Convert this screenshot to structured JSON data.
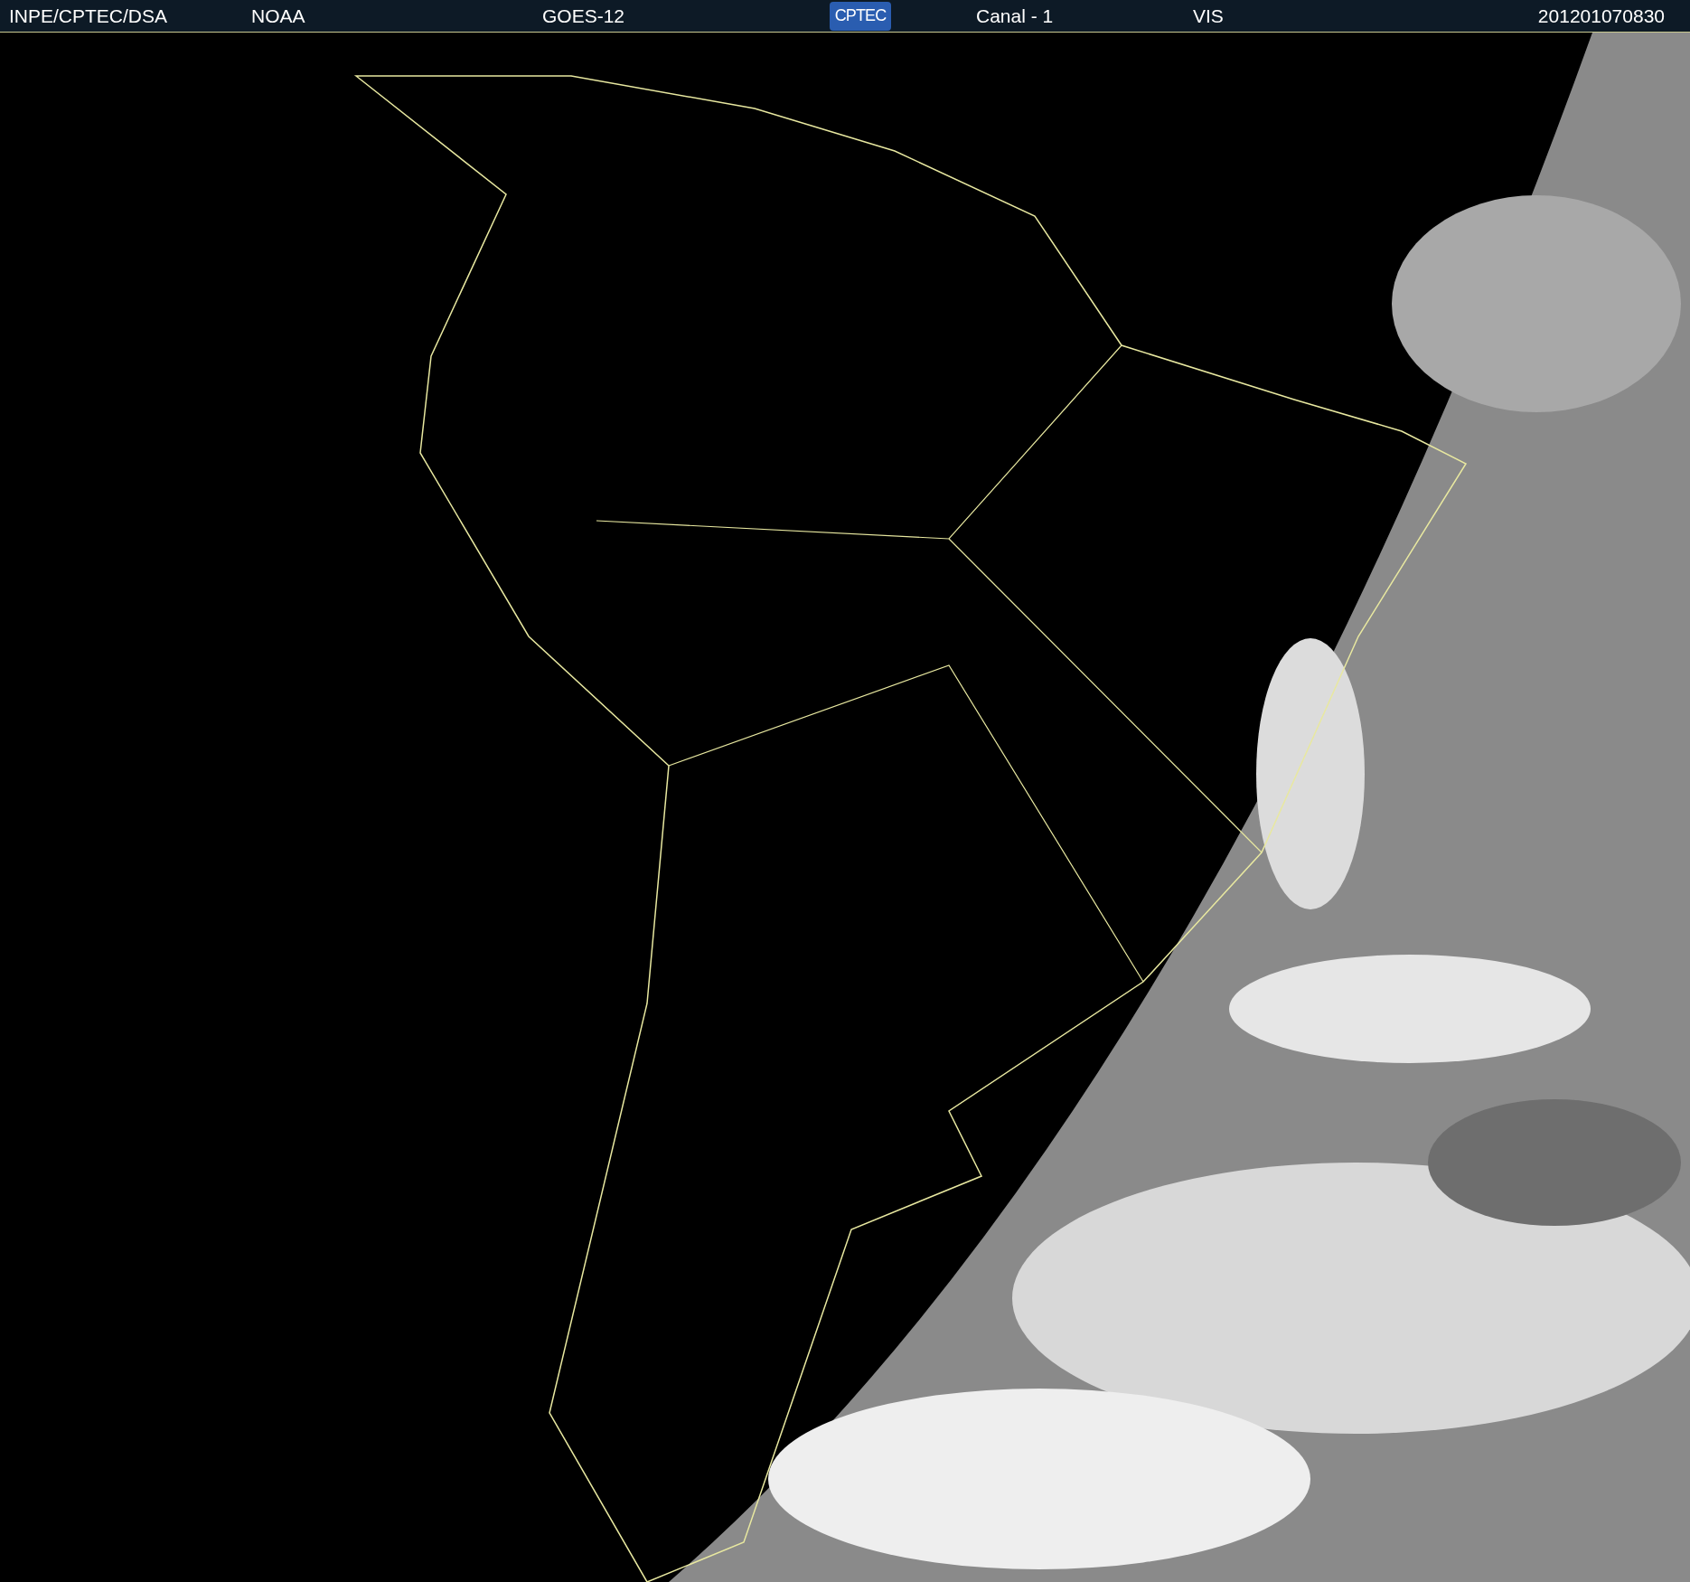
{
  "header": {
    "left": [
      {
        "text": "INPE/CPTEC/DSA"
      },
      {
        "text": "NOAA"
      },
      {
        "text": "GOES-12"
      }
    ],
    "logo": "CPTEC",
    "right": [
      {
        "text": "Canal - 1"
      },
      {
        "text": "VIS"
      },
      {
        "text": "201201070830"
      }
    ]
  }
}
